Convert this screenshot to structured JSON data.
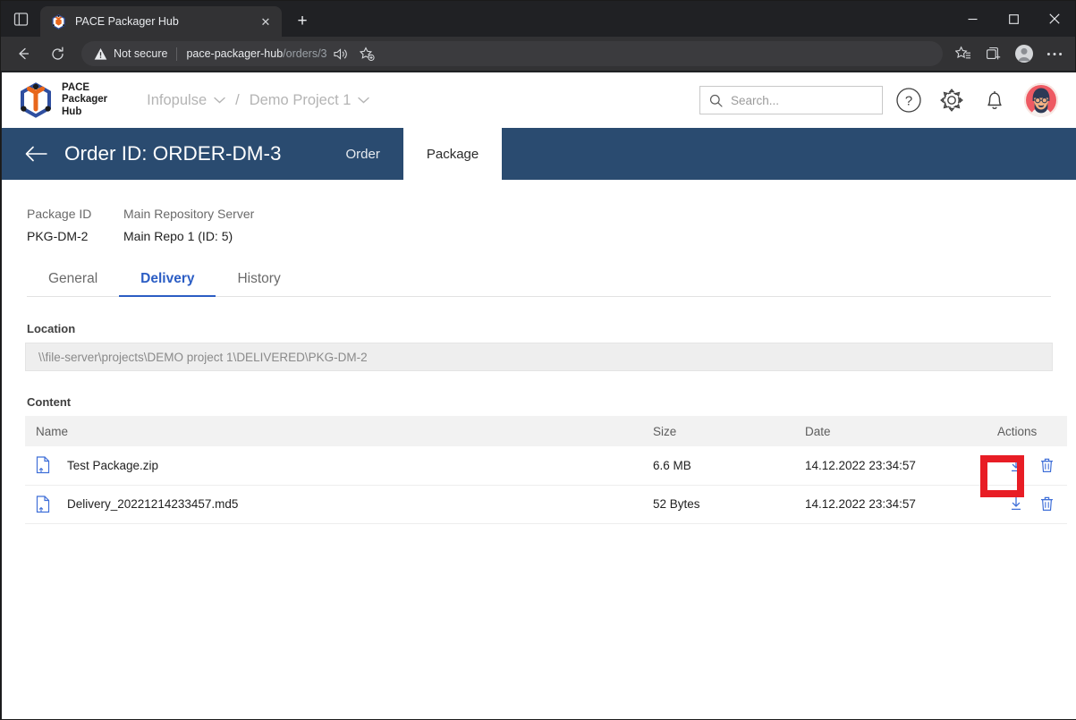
{
  "browser": {
    "tab": {
      "title": "PACE Packager Hub",
      "favicon": "pace-hexagon-logo-icon",
      "close_label": "✕"
    },
    "new_tab_label": "+",
    "window_controls": {
      "minimize": "—",
      "maximize": "□",
      "close": "✕"
    },
    "security_label": "Not secure",
    "url_host": "pace-packager-hub",
    "url_path": "/orders/3",
    "icons": {
      "tab_list": "tab-list-icon",
      "back": "back-arrow-icon",
      "reload": "reload-icon",
      "warning": "warning-triangle-icon",
      "read_aloud": "read-aloud-icon",
      "add_favorite": "add-favorite-star-icon",
      "favorites": "favorites-list-icon",
      "collections": "collections-icon",
      "profile": "profile-avatar-icon",
      "settings_more": "more-options-icon"
    }
  },
  "app": {
    "logo": {
      "icon": "pace-hexagon-logo-icon",
      "line1": "PACE",
      "line2": "Packager",
      "line3": "Hub"
    },
    "breadcrumbs": [
      {
        "label": "Infopulse",
        "chevron": "chevron-down-icon"
      },
      {
        "label": "Demo Project 1",
        "chevron": "chevron-down-icon"
      }
    ],
    "breadcrumb_separator": "/",
    "search": {
      "placeholder": "Search...",
      "value": "",
      "icon": "search-icon"
    },
    "header_icons": [
      {
        "name": "help-icon",
        "glyph": "?"
      },
      {
        "name": "settings-gear-icon"
      },
      {
        "name": "notifications-bell-icon"
      }
    ],
    "avatar": {
      "name": "user-avatar",
      "alt": "bearded-man-avatar"
    }
  },
  "order_bar": {
    "back_icon": "back-arrow-icon",
    "title": "Order ID: ORDER-DM-3",
    "tabs": [
      {
        "label": "Order",
        "active": false
      },
      {
        "label": "Package",
        "active": true
      }
    ]
  },
  "package": {
    "fields": [
      {
        "label": "Package ID",
        "value": "PKG-DM-2"
      },
      {
        "label": "Main Repository Server",
        "value": "Main Repo 1 (ID: 5)"
      }
    ],
    "tabs": [
      {
        "label": "General",
        "active": false
      },
      {
        "label": "Delivery",
        "active": true
      },
      {
        "label": "History",
        "active": false
      }
    ],
    "location": {
      "label": "Location",
      "value": "\\\\file-server\\projects\\DEMO project 1\\DELIVERED\\PKG-DM-2"
    },
    "content": {
      "label": "Content",
      "columns": [
        "Name",
        "Size",
        "Date",
        "Actions"
      ],
      "rows": [
        {
          "icon": "file-document-icon",
          "name": "Test Package.zip",
          "size": "6.6 MB",
          "date": "14.12.2022 23:34:57",
          "actions": [
            {
              "name": "download-icon",
              "highlighted": true
            },
            {
              "name": "delete-trash-icon",
              "highlighted": false
            }
          ]
        },
        {
          "icon": "file-document-icon",
          "name": "Delivery_20221214233457.md5",
          "size": "52 Bytes",
          "date": "14.12.2022 23:34:57",
          "actions": [
            {
              "name": "download-icon",
              "highlighted": false
            },
            {
              "name": "delete-trash-icon",
              "highlighted": false
            }
          ]
        }
      ]
    }
  },
  "annotation": {
    "highlight_color": "#e81d25",
    "target": "download-icon-row-1"
  },
  "colors": {
    "order_bar_blue": "#2a4b70",
    "accent_blue": "#2b5dc4",
    "browser_chrome": "#202124",
    "table_header_grey": "#f2f2f2"
  }
}
